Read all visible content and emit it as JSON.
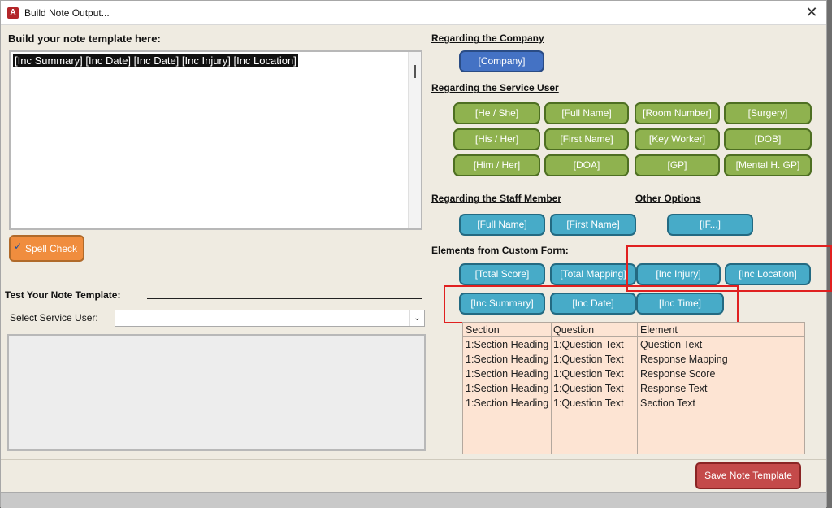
{
  "window": {
    "title": "Build Note Output...",
    "close_glyph": "✕",
    "app_icon": "A"
  },
  "left": {
    "build_heading": "Build your note template here:",
    "template_text": "[Inc Summary] [Inc Date] [Inc Date] [Inc Injury] [Inc Location]",
    "spell_check": "Spell Check",
    "test_heading": "Test Your Note Template:",
    "select_label": "Select Service User:",
    "select_value": ""
  },
  "right": {
    "company_heading": "Regarding the Company",
    "company_buttons": [
      "[Company]"
    ],
    "service_heading": "Regarding the Service User",
    "service_buttons": [
      "[He / She]",
      "[Full Name]",
      "[Room Number]",
      "[Surgery]",
      "[His / Her]",
      "[First Name]",
      "[Key Worker]",
      "[DOB]",
      "[Him / Her]",
      "[DOA]",
      "[GP]",
      "[Mental H. GP]"
    ],
    "staff_heading": "Regarding the Staff Member",
    "staff_buttons": [
      "[Full Name]",
      "[First Name]"
    ],
    "other_heading": "Other Options",
    "other_buttons": [
      "[IF...]"
    ],
    "custom_heading": "Elements from Custom Form:",
    "custom_buttons": [
      "[Total Score]",
      "[Total Mapping]",
      "[Inc Injury]",
      "[Inc Location]",
      "[Inc Summary]",
      "[Inc Date]",
      "[Inc Time]"
    ]
  },
  "table": {
    "columns": [
      "Section",
      "Question",
      "Element"
    ],
    "rows": [
      [
        "1:Section Heading",
        "1:Question Text",
        "Question Text"
      ],
      [
        "1:Section Heading",
        "1:Question Text",
        "Response Mapping"
      ],
      [
        "1:Section Heading",
        "1:Question Text",
        "Response Score"
      ],
      [
        "1:Section Heading",
        "1:Question Text",
        "Response Text"
      ],
      [
        "1:Section Heading",
        "1:Question Text",
        "Section Text"
      ]
    ]
  },
  "footer": {
    "save_label": "Save Note Template"
  },
  "colors": {
    "company": "#4472c4",
    "service": "#8fb24f",
    "staff": "#47abc8",
    "spell": "#f08d3e",
    "save": "#c44a4a",
    "highlight": "#e02020",
    "table_bg": "#fde4d3"
  },
  "icons": {
    "app": "access-app-icon",
    "spell": "spell-check-icon",
    "close": "close-icon",
    "dropdown": "chevron-down-icon"
  }
}
